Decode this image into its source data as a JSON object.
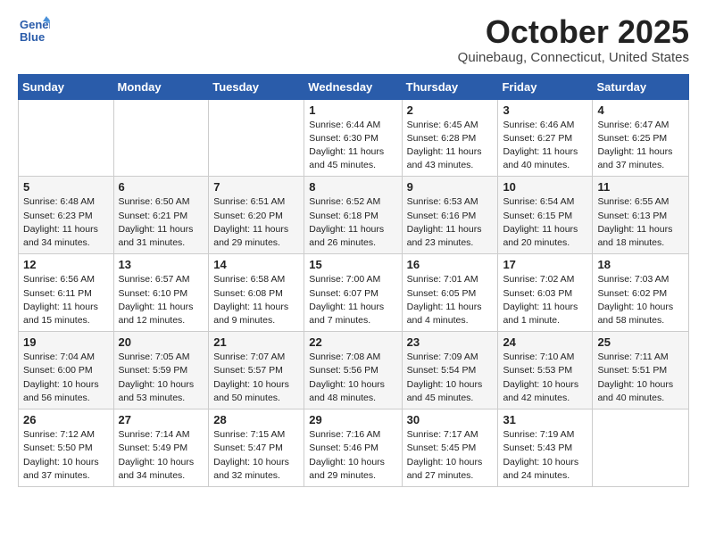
{
  "header": {
    "logo_line1": "General",
    "logo_line2": "Blue",
    "month": "October 2025",
    "location": "Quinebaug, Connecticut, United States"
  },
  "weekdays": [
    "Sunday",
    "Monday",
    "Tuesday",
    "Wednesday",
    "Thursday",
    "Friday",
    "Saturday"
  ],
  "weeks": [
    [
      {
        "day": "",
        "info": ""
      },
      {
        "day": "",
        "info": ""
      },
      {
        "day": "",
        "info": ""
      },
      {
        "day": "1",
        "info": "Sunrise: 6:44 AM\nSunset: 6:30 PM\nDaylight: 11 hours\nand 45 minutes."
      },
      {
        "day": "2",
        "info": "Sunrise: 6:45 AM\nSunset: 6:28 PM\nDaylight: 11 hours\nand 43 minutes."
      },
      {
        "day": "3",
        "info": "Sunrise: 6:46 AM\nSunset: 6:27 PM\nDaylight: 11 hours\nand 40 minutes."
      },
      {
        "day": "4",
        "info": "Sunrise: 6:47 AM\nSunset: 6:25 PM\nDaylight: 11 hours\nand 37 minutes."
      }
    ],
    [
      {
        "day": "5",
        "info": "Sunrise: 6:48 AM\nSunset: 6:23 PM\nDaylight: 11 hours\nand 34 minutes."
      },
      {
        "day": "6",
        "info": "Sunrise: 6:50 AM\nSunset: 6:21 PM\nDaylight: 11 hours\nand 31 minutes."
      },
      {
        "day": "7",
        "info": "Sunrise: 6:51 AM\nSunset: 6:20 PM\nDaylight: 11 hours\nand 29 minutes."
      },
      {
        "day": "8",
        "info": "Sunrise: 6:52 AM\nSunset: 6:18 PM\nDaylight: 11 hours\nand 26 minutes."
      },
      {
        "day": "9",
        "info": "Sunrise: 6:53 AM\nSunset: 6:16 PM\nDaylight: 11 hours\nand 23 minutes."
      },
      {
        "day": "10",
        "info": "Sunrise: 6:54 AM\nSunset: 6:15 PM\nDaylight: 11 hours\nand 20 minutes."
      },
      {
        "day": "11",
        "info": "Sunrise: 6:55 AM\nSunset: 6:13 PM\nDaylight: 11 hours\nand 18 minutes."
      }
    ],
    [
      {
        "day": "12",
        "info": "Sunrise: 6:56 AM\nSunset: 6:11 PM\nDaylight: 11 hours\nand 15 minutes."
      },
      {
        "day": "13",
        "info": "Sunrise: 6:57 AM\nSunset: 6:10 PM\nDaylight: 11 hours\nand 12 minutes."
      },
      {
        "day": "14",
        "info": "Sunrise: 6:58 AM\nSunset: 6:08 PM\nDaylight: 11 hours\nand 9 minutes."
      },
      {
        "day": "15",
        "info": "Sunrise: 7:00 AM\nSunset: 6:07 PM\nDaylight: 11 hours\nand 7 minutes."
      },
      {
        "day": "16",
        "info": "Sunrise: 7:01 AM\nSunset: 6:05 PM\nDaylight: 11 hours\nand 4 minutes."
      },
      {
        "day": "17",
        "info": "Sunrise: 7:02 AM\nSunset: 6:03 PM\nDaylight: 11 hours\nand 1 minute."
      },
      {
        "day": "18",
        "info": "Sunrise: 7:03 AM\nSunset: 6:02 PM\nDaylight: 10 hours\nand 58 minutes."
      }
    ],
    [
      {
        "day": "19",
        "info": "Sunrise: 7:04 AM\nSunset: 6:00 PM\nDaylight: 10 hours\nand 56 minutes."
      },
      {
        "day": "20",
        "info": "Sunrise: 7:05 AM\nSunset: 5:59 PM\nDaylight: 10 hours\nand 53 minutes."
      },
      {
        "day": "21",
        "info": "Sunrise: 7:07 AM\nSunset: 5:57 PM\nDaylight: 10 hours\nand 50 minutes."
      },
      {
        "day": "22",
        "info": "Sunrise: 7:08 AM\nSunset: 5:56 PM\nDaylight: 10 hours\nand 48 minutes."
      },
      {
        "day": "23",
        "info": "Sunrise: 7:09 AM\nSunset: 5:54 PM\nDaylight: 10 hours\nand 45 minutes."
      },
      {
        "day": "24",
        "info": "Sunrise: 7:10 AM\nSunset: 5:53 PM\nDaylight: 10 hours\nand 42 minutes."
      },
      {
        "day": "25",
        "info": "Sunrise: 7:11 AM\nSunset: 5:51 PM\nDaylight: 10 hours\nand 40 minutes."
      }
    ],
    [
      {
        "day": "26",
        "info": "Sunrise: 7:12 AM\nSunset: 5:50 PM\nDaylight: 10 hours\nand 37 minutes."
      },
      {
        "day": "27",
        "info": "Sunrise: 7:14 AM\nSunset: 5:49 PM\nDaylight: 10 hours\nand 34 minutes."
      },
      {
        "day": "28",
        "info": "Sunrise: 7:15 AM\nSunset: 5:47 PM\nDaylight: 10 hours\nand 32 minutes."
      },
      {
        "day": "29",
        "info": "Sunrise: 7:16 AM\nSunset: 5:46 PM\nDaylight: 10 hours\nand 29 minutes."
      },
      {
        "day": "30",
        "info": "Sunrise: 7:17 AM\nSunset: 5:45 PM\nDaylight: 10 hours\nand 27 minutes."
      },
      {
        "day": "31",
        "info": "Sunrise: 7:19 AM\nSunset: 5:43 PM\nDaylight: 10 hours\nand 24 minutes."
      },
      {
        "day": "",
        "info": ""
      }
    ]
  ]
}
